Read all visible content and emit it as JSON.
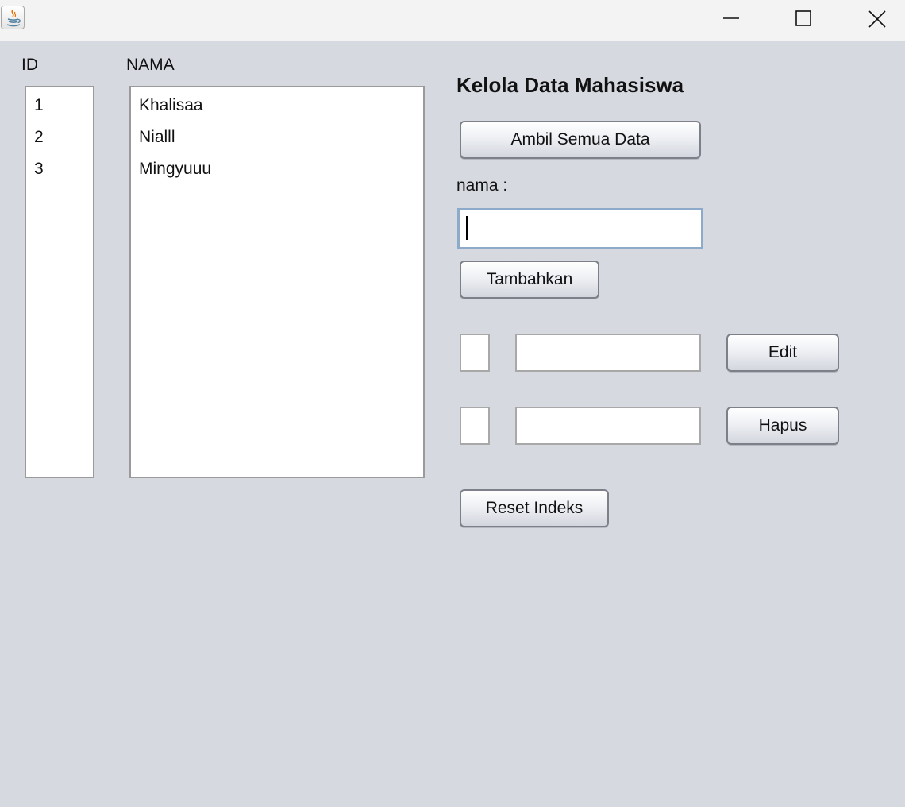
{
  "window": {
    "icon": "java-icon",
    "controls": [
      "minimize-icon",
      "maximize-icon",
      "close-icon"
    ]
  },
  "lists": {
    "id_header": "ID",
    "nama_header": "NAMA",
    "ids": [
      "1",
      "2",
      "3"
    ],
    "names": [
      "Khalisaa",
      "Nialll",
      "Mingyuuu"
    ]
  },
  "form": {
    "title": "Kelola Data Mahasiswa",
    "ambil_label": "Ambil Semua Data",
    "nama_label": "nama :",
    "nama_value": "",
    "tambah_label": "Tambahkan",
    "edit_id_value": "",
    "edit_nama_value": "",
    "edit_label": "Edit",
    "hapus_id_value": "",
    "hapus_nama_value": "",
    "hapus_label": "Hapus",
    "reset_label": "Reset Indeks"
  }
}
